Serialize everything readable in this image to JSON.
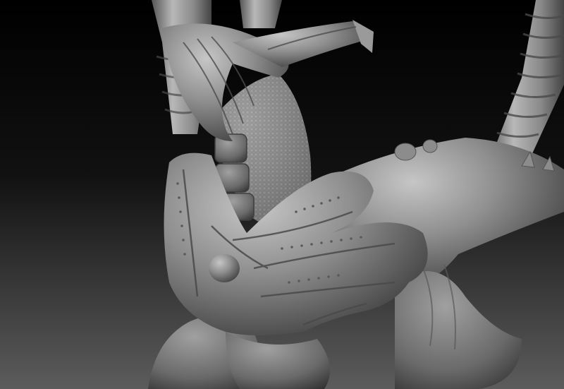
{
  "scene": {
    "kind": "3d-sculpt-render",
    "subject": "clay-render-of-mechanical-creature-with-grasping-hands",
    "material_color": "#8e8e8e",
    "shadow_color": "#3a3a3a",
    "highlight_color": "#c4c4c4",
    "background_top": "#000000",
    "background_bottom": "#5a5a5a"
  }
}
